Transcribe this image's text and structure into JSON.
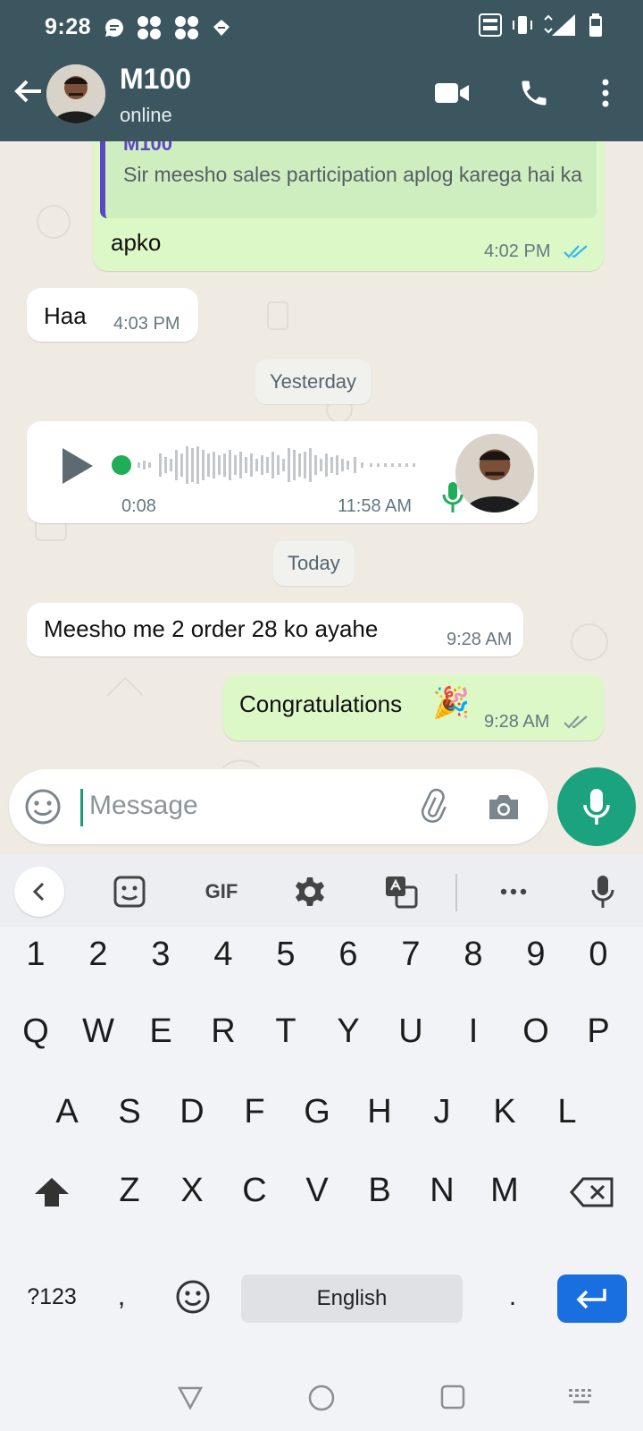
{
  "status_bar": {
    "time": "9:28"
  },
  "header": {
    "name": "M100",
    "status": "online"
  },
  "messages": [
    {
      "quote_author": "M100",
      "quote_text": "Sir meesho sales participation aplog karega hai ka",
      "text": "apko",
      "time": "4:02 PM"
    },
    {
      "text": "Haa",
      "time": "4:03 PM"
    },
    {
      "date": "Yesterday"
    },
    {
      "voice_duration": "0:08",
      "time": "11:58 AM"
    },
    {
      "date": "Today"
    },
    {
      "text": "Meesho me 2 order 28 ko ayahe",
      "time": "9:28 AM"
    },
    {
      "text": "Congratulations",
      "emoji": "🎉",
      "time": "9:28 AM"
    }
  ],
  "composer": {
    "placeholder": "Message"
  },
  "keyboard": {
    "toolbar": {
      "gif": "GIF"
    },
    "row1": [
      "1",
      "2",
      "3",
      "4",
      "5",
      "6",
      "7",
      "8",
      "9",
      "0"
    ],
    "row2": [
      "Q",
      "W",
      "E",
      "R",
      "T",
      "Y",
      "U",
      "I",
      "O",
      "P"
    ],
    "row3": [
      "A",
      "S",
      "D",
      "F",
      "G",
      "H",
      "J",
      "K",
      "L"
    ],
    "row4": [
      "Z",
      "X",
      "C",
      "V",
      "B",
      "N",
      "M"
    ],
    "bottom": {
      "symbols": "?123",
      "comma": ",",
      "space": "English",
      "period": "."
    }
  },
  "colors": {
    "header": "#3c5660",
    "outgoing": "#dcf8c6",
    "accent": "#1aa37e",
    "read_tick": "#34b7f1"
  }
}
